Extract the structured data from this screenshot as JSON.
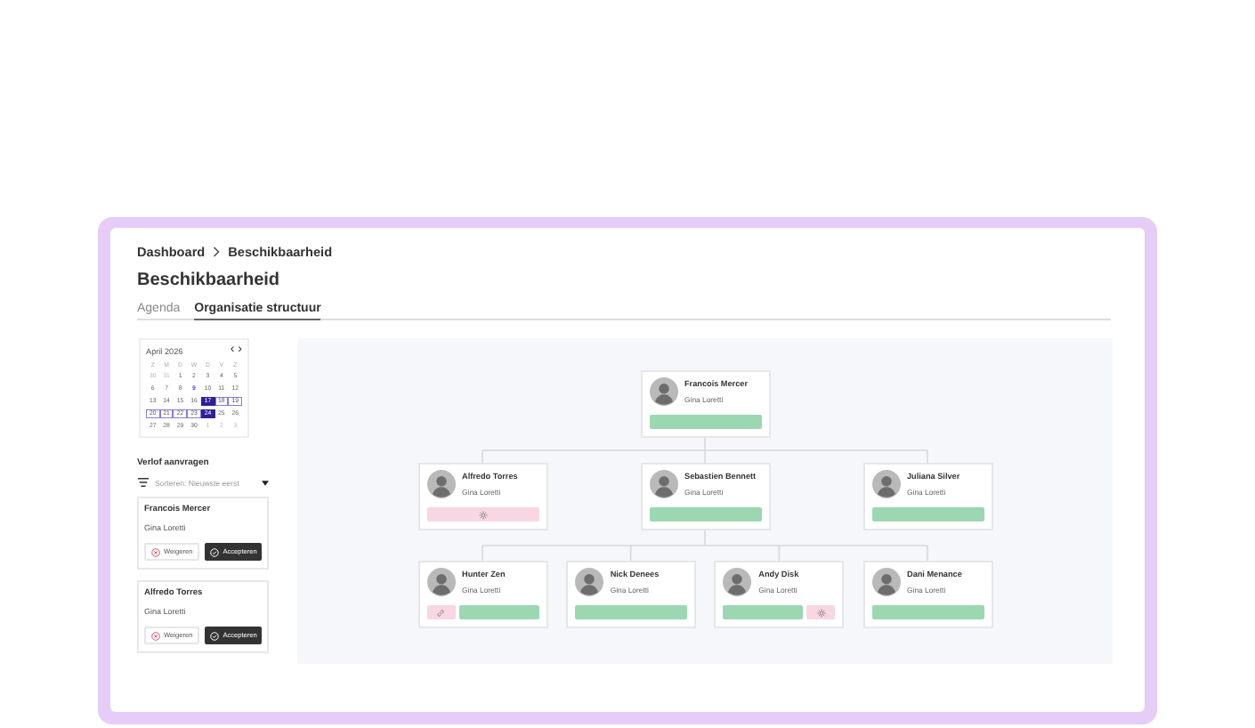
{
  "breadcrumb": [
    "Dashboard",
    "Beschikbaarheid"
  ],
  "title": "Beschikbaarheid",
  "tabs": [
    {
      "label": "Agenda",
      "selected": false
    },
    {
      "label": "Organisatie structuur",
      "selected": true
    }
  ],
  "calendar": {
    "month": "April 2026",
    "prev": "‹",
    "next": "›",
    "weekdays": [
      "Z",
      "M",
      "D",
      "W",
      "D",
      "V",
      "Z"
    ],
    "weeks": [
      [
        {
          "day": "30",
          "muted": true
        },
        {
          "day": "31",
          "muted": true
        },
        {
          "day": "1"
        },
        {
          "day": "2"
        },
        {
          "day": "3"
        },
        {
          "day": "4"
        },
        {
          "day": "5"
        }
      ],
      [
        {
          "day": "6"
        },
        {
          "day": "7"
        },
        {
          "day": "8"
        },
        {
          "day": "9",
          "today": true
        },
        {
          "day": "10"
        },
        {
          "day": "11"
        },
        {
          "day": "12"
        }
      ],
      [
        {
          "day": "13"
        },
        {
          "day": "14"
        },
        {
          "day": "15"
        },
        {
          "day": "16"
        },
        {
          "day": "17",
          "selected": true
        },
        {
          "day": "18",
          "in_range": true
        },
        {
          "day": "19",
          "in_range": true
        }
      ],
      [
        {
          "day": "20",
          "in_range": true
        },
        {
          "day": "21",
          "in_range": true
        },
        {
          "day": "22",
          "in_range": true
        },
        {
          "day": "23",
          "in_range": true
        },
        {
          "day": "24",
          "selected": true
        },
        {
          "day": "25"
        },
        {
          "day": "26"
        }
      ],
      [
        {
          "day": "27"
        },
        {
          "day": "28"
        },
        {
          "day": "29"
        },
        {
          "day": "30"
        },
        {
          "day": "1",
          "muted": true
        },
        {
          "day": "2",
          "muted": true
        },
        {
          "day": "3",
          "muted": true
        }
      ]
    ]
  },
  "requests_title": "Verlof aanvragen",
  "sort": "Sorteren: Nieuwste eerst",
  "requests": [
    {
      "name": "Francois Mercer",
      "manager": "Gina Loretti",
      "reject": "Weigeren",
      "accept": "Accepteren"
    },
    {
      "name": "Alfredo Torres",
      "manager": "Gina Loretti",
      "reject": "Weigeren",
      "accept": "Accepteren"
    }
  ],
  "org": {
    "name": "Francois Mercer",
    "manager": "Gina Loretti",
    "segments": [
      {
        "kind": "available"
      }
    ],
    "children": [
      {
        "name": "Alfredo Torres",
        "manager": "Gina Loretti",
        "segments": [
          {
            "kind": "sun"
          }
        ]
      },
      {
        "name": "Sebastien Bennett",
        "manager": "Gina Loretti",
        "segments": [
          {
            "kind": "available"
          }
        ],
        "children": [
          {
            "name": "Hunter Zen",
            "manager": "Gina Loretti",
            "segments": [
              {
                "kind": "link"
              },
              {
                "kind": "available"
              }
            ]
          },
          {
            "name": "Nick Denees",
            "manager": "Gina Loretti",
            "segments": [
              {
                "kind": "available"
              }
            ]
          },
          {
            "name": "Andy Disk",
            "manager": "Gina Loretti",
            "segments": [
              {
                "kind": "available"
              },
              {
                "kind": "sun"
              }
            ]
          },
          {
            "name": "Dani Menance",
            "manager": "Gina Loretti",
            "segments": [
              {
                "kind": "available"
              }
            ]
          }
        ]
      },
      {
        "name": "Juliana Silver",
        "manager": "Gina Loretti",
        "segments": [
          {
            "kind": "available"
          }
        ]
      }
    ]
  }
}
